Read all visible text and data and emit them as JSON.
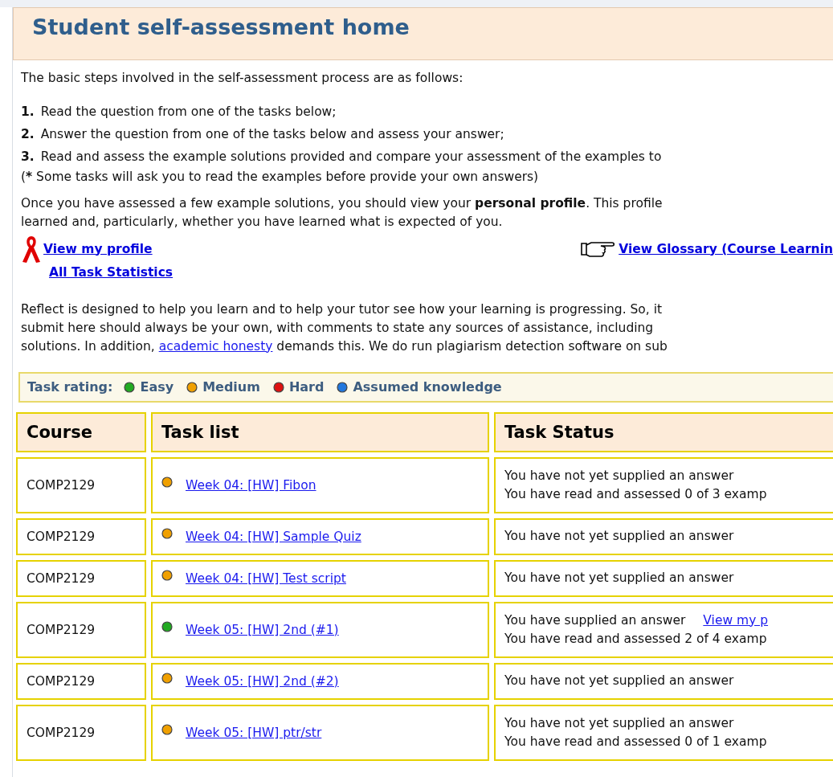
{
  "title": "Student self-assessment home",
  "intro": "The basic steps involved in the self-assessment process are as follows:",
  "steps": [
    {
      "number": "1.",
      "text": "Read the question from one of the tasks below;"
    },
    {
      "number": "2.",
      "text": "Answer the question from one of the tasks below and assess your answer;"
    },
    {
      "number": "3.",
      "text": "Read and assess the example solutions provided and compare your assessment of the examples to"
    }
  ],
  "note": {
    "open": "(",
    "mark": "*",
    "text": " Some tasks will ask you to read the examples before provide your own answers)"
  },
  "profile_text": [
    "Once you have assessed a few example solutions, you should view your **personal profile**. This profile",
    "learned and, particularly, whether you have learned what is expected of you."
  ],
  "links": {
    "profile": "View my profile",
    "statistics": "All Task Statistics",
    "glossary": "View Glossary (Course Learnin"
  },
  "honesty_text": [
    "Reflect is designed to help you learn and to help your tutor see how your learning is progressing. So, it",
    "submit here should always be your own, with comments to state any sources of assistance, including"
  ],
  "honesty_last": {
    "before": "solutions. In addition, ",
    "link": "academic honesty",
    "after": " demands this. We do run plagiarism detection software on sub"
  },
  "rating": {
    "label": "Task rating:",
    "levels": [
      {
        "label": "Easy",
        "color": "#22aa22"
      },
      {
        "label": "Medium",
        "color": "#f0a000"
      },
      {
        "label": "Hard",
        "color": "#dd1111"
      },
      {
        "label": "Assumed knowledge",
        "color": "#2277dd"
      }
    ]
  },
  "table": {
    "columns": [
      "Course",
      "Task list",
      "Task Status"
    ],
    "rows": [
      {
        "course": "COMP2129",
        "task": "Week 04: [HW] Fibon",
        "color": "#f0a000",
        "status": [
          {
            "text": "You have not yet supplied an answer"
          },
          {
            "text": "You have read and assessed 0 of 3 examp"
          }
        ]
      },
      {
        "course": "COMP2129",
        "task": "Week 04: [HW] Sample Quiz",
        "color": "#f0a000",
        "status": [
          {
            "text": "You have not yet supplied an answer"
          }
        ]
      },
      {
        "course": "COMP2129",
        "task": "Week 04: [HW] Test script",
        "color": "#f0a000",
        "status": [
          {
            "text": "You have not yet supplied an answer"
          }
        ]
      },
      {
        "course": "COMP2129",
        "task": "Week 05: [HW] 2nd (#1)",
        "color": "#22aa22",
        "status": [
          {
            "text": "You have supplied an answer",
            "link": "View my p"
          },
          {
            "text": "You have read and assessed 2 of 4 examp"
          }
        ]
      },
      {
        "course": "COMP2129",
        "task": "Week 05: [HW] 2nd (#2)",
        "color": "#f0a000",
        "status": [
          {
            "text": "You have not yet supplied an answer"
          }
        ]
      },
      {
        "course": "COMP2129",
        "task": "Week 05: [HW] ptr/str",
        "color": "#f0a000",
        "status": [
          {
            "text": "You have not yet supplied an answer"
          },
          {
            "text": "You have read and assessed 0 of 1 examp"
          }
        ]
      }
    ]
  }
}
